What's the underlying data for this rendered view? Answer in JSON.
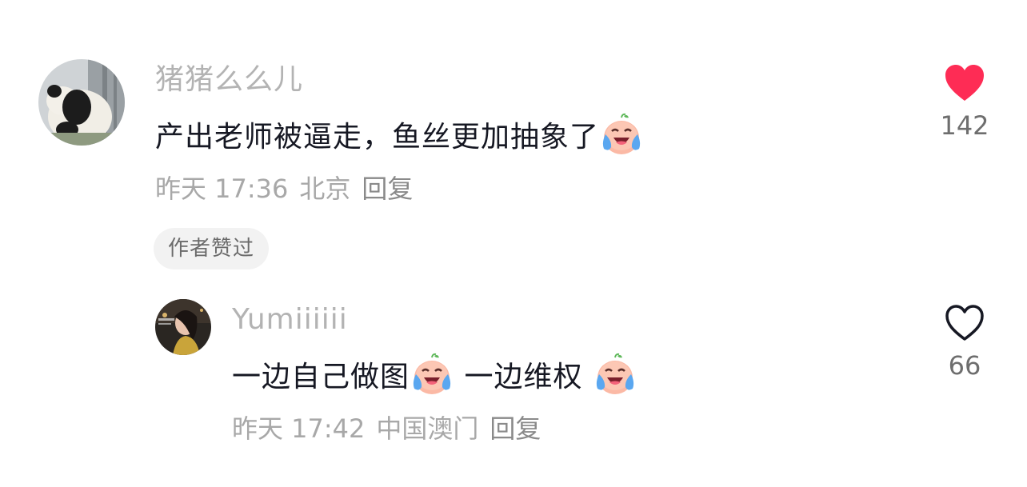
{
  "comments": [
    {
      "username": "猪猪么么儿",
      "text": "产出老师被逼走，鱼丝更加抽象了",
      "emoji": "crying-laughing-face-icon",
      "time": "昨天 17:36",
      "location": "北京",
      "reply_label": "回复",
      "badge": "作者赞过",
      "likes": "142",
      "liked": true
    },
    {
      "username": "Yumiiiiii",
      "text_parts": [
        "一边自己做图",
        " 一边维权 "
      ],
      "emoji": "crying-laughing-face-icon",
      "time": "昨天 17:42",
      "location": "中国澳门",
      "reply_label": "回复",
      "likes": "66",
      "liked": false
    }
  ],
  "colors": {
    "like_active": "#fe2c55",
    "like_inactive": "#161823",
    "username": "#b3b3b3",
    "text": "#161823",
    "meta": "#a8a8a8"
  }
}
